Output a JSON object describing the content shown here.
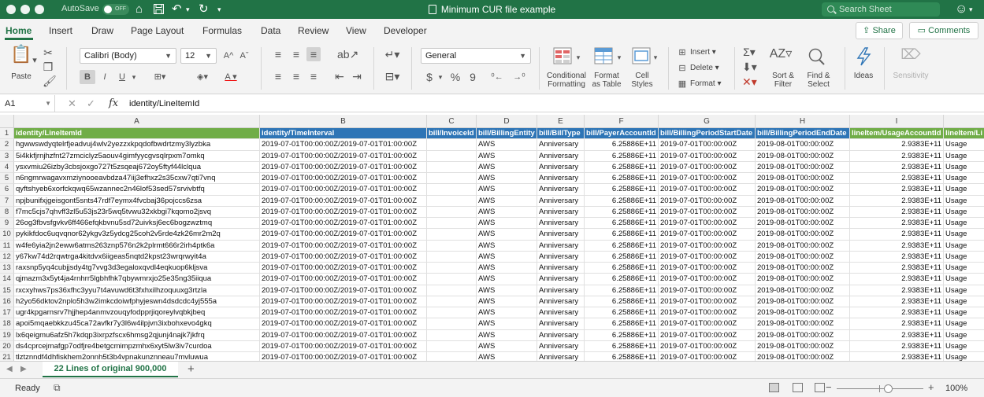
{
  "window": {
    "autosave_label": "AutoSave",
    "autosave_state": "OFF",
    "title": "Minimum CUR file example",
    "search_placeholder": "Search Sheet"
  },
  "ribbon_tabs": [
    "Home",
    "Insert",
    "Draw",
    "Page Layout",
    "Formulas",
    "Data",
    "Review",
    "View",
    "Developer"
  ],
  "actions": {
    "share": "Share",
    "comments": "Comments"
  },
  "ribbon": {
    "paste": "Paste",
    "font_name": "Calibri (Body)",
    "font_size": "12",
    "bold": "B",
    "italic": "I",
    "underline": "U",
    "number_format": "General",
    "currency": "$",
    "percent": "%",
    "comma": "9",
    "conditional_formatting": [
      "Conditional",
      "Formatting"
    ],
    "format_as_table": [
      "Format",
      "as Table"
    ],
    "cell_styles": [
      "Cell",
      "Styles"
    ],
    "insert": "Insert",
    "delete": "Delete",
    "format": "Format",
    "sort_filter": [
      "Sort &",
      "Filter"
    ],
    "find_select": [
      "Find &",
      "Select"
    ],
    "ideas": "Ideas",
    "sensitivity": "Sensitivity"
  },
  "formula_bar": {
    "name_box": "A1",
    "fx": "fx",
    "content": "identity/LineItemId"
  },
  "grid": {
    "column_letters": [
      "A",
      "B",
      "C",
      "D",
      "E",
      "F",
      "G",
      "H",
      "I"
    ],
    "headers": [
      "identity/LineItemId",
      "identity/TimeInterval",
      "bill/InvoiceId",
      "bill/BillingEntity",
      "bill/BillType",
      "bill/PayerAccountId",
      "bill/BillingPeriodStartDate",
      "bill/BillingPeriodEndDate",
      "lineItem/UsageAccountId",
      "lineItem/Li"
    ],
    "row_numbers": [
      "1",
      "2",
      "3",
      "4",
      "5",
      "6",
      "7",
      "8",
      "9",
      "10",
      "11",
      "12",
      "13",
      "14",
      "15",
      "16",
      "17",
      "18",
      "19",
      "20",
      "21"
    ],
    "rows": [
      [
        "hgwwswdyqtelrfjeadvuj4wlv2yezzxkpqdofbwdrtzmy3lyzbka",
        "2019-07-01T00:00:00Z/2019-07-01T01:00:00Z",
        "",
        "AWS",
        "Anniversary",
        "6.25886E+11",
        "2019-07-01T00:00:00Z",
        "2019-08-01T00:00:00Z",
        "2.9383E+11",
        "Usage"
      ],
      [
        "5i4kkfjrnjhzfnt27zmciclyz5aouv4gimfyycgvsqlrpxm7omkq",
        "2019-07-01T00:00:00Z/2019-07-01T01:00:00Z",
        "",
        "AWS",
        "Anniversary",
        "6.25886E+11",
        "2019-07-01T00:00:00Z",
        "2019-08-01T00:00:00Z",
        "2.9383E+11",
        "Usage"
      ],
      [
        "ysxvmiu26izby3cbsjoxgo727t5zsqeaj672oy5ftyf44lclqua",
        "2019-07-01T00:00:00Z/2019-07-01T01:00:00Z",
        "",
        "AWS",
        "Anniversary",
        "6.25886E+11",
        "2019-07-01T00:00:00Z",
        "2019-08-01T00:00:00Z",
        "2.9383E+11",
        "Usage"
      ],
      [
        "n6ngmrwagavxmziynooeavbdza47iij3efhxz2s35cxw7qti7vnq",
        "2019-07-01T00:00:00Z/2019-07-01T01:00:00Z",
        "",
        "AWS",
        "Anniversary",
        "6.25886E+11",
        "2019-07-01T00:00:00Z",
        "2019-08-01T00:00:00Z",
        "2.9383E+11",
        "Usage"
      ],
      [
        "qyftshyeb6xorfckqwq65wzannec2n46lof53sed57srvivbtfq",
        "2019-07-01T00:00:00Z/2019-07-01T01:00:00Z",
        "",
        "AWS",
        "Anniversary",
        "6.25886E+11",
        "2019-07-01T00:00:00Z",
        "2019-08-01T00:00:00Z",
        "2.9383E+11",
        "Usage"
      ],
      [
        "npjbunifxjgeisgont5snts47rdf7eymx4fvcbaj36pojccs6zsa",
        "2019-07-01T00:00:00Z/2019-07-01T01:00:00Z",
        "",
        "AWS",
        "Anniversary",
        "6.25886E+11",
        "2019-07-01T00:00:00Z",
        "2019-08-01T00:00:00Z",
        "2.9383E+11",
        "Usage"
      ],
      [
        "f7mc5cjs7qhvff3zl5u53js23r5wq5tvwu32xkbgi7kqomo2jsvq",
        "2019-07-01T00:00:00Z/2019-07-01T01:00:00Z",
        "",
        "AWS",
        "Anniversary",
        "6.25886E+11",
        "2019-07-01T00:00:00Z",
        "2019-08-01T00:00:00Z",
        "2.9383E+11",
        "Usage"
      ],
      [
        "26og3fbvsfgvkv6ff466efqkbvnu5sd72uivksj6ec6bogzwztmq",
        "2019-07-01T00:00:00Z/2019-07-01T01:00:00Z",
        "",
        "AWS",
        "Anniversary",
        "6.25886E+11",
        "2019-07-01T00:00:00Z",
        "2019-08-01T00:00:00Z",
        "2.9383E+11",
        "Usage"
      ],
      [
        "pykikfdoc6uqvqnor62ykgv3z5ydcg25coh2v5rde4zk26mr2m2q",
        "2019-07-01T00:00:00Z/2019-07-01T01:00:00Z",
        "",
        "AWS",
        "Anniversary",
        "6.25886E+11",
        "2019-07-01T00:00:00Z",
        "2019-08-01T00:00:00Z",
        "2.9383E+11",
        "Usage"
      ],
      [
        "w4fe6yia2jn2eww6atms263znp576n2k2plrmt666r2irh4ptk6a",
        "2019-07-01T00:00:00Z/2019-07-01T01:00:00Z",
        "",
        "AWS",
        "Anniversary",
        "6.25886E+11",
        "2019-07-01T00:00:00Z",
        "2019-08-01T00:00:00Z",
        "2.9383E+11",
        "Usage"
      ],
      [
        "y67kw74d2rqwtrga4kitdvx6iigeas5nqtd2kpst23wrqrwyit4a",
        "2019-07-01T00:00:00Z/2019-07-01T01:00:00Z",
        "",
        "AWS",
        "Anniversary",
        "6.25886E+11",
        "2019-07-01T00:00:00Z",
        "2019-08-01T00:00:00Z",
        "2.9383E+11",
        "Usage"
      ],
      [
        "raxsnp5yq4cubjjsdy4tg7vvg3d3egaloxqvdl4eqkuop6kljsva",
        "2019-07-01T00:00:00Z/2019-07-01T01:00:00Z",
        "",
        "AWS",
        "Anniversary",
        "6.25886E+11",
        "2019-07-01T00:00:00Z",
        "2019-08-01T00:00:00Z",
        "2.9383E+11",
        "Usage"
      ],
      [
        "qjmazm3x5yt4ja4rnhrr5lgbhfhk7qbywmrxjo25e35ng35iiqua",
        "2019-07-01T00:00:00Z/2019-07-01T01:00:00Z",
        "",
        "AWS",
        "Anniversary",
        "6.25886E+11",
        "2019-07-01T00:00:00Z",
        "2019-08-01T00:00:00Z",
        "2.9383E+11",
        "Usage"
      ],
      [
        "rxcxyhws7ps36xfhc3yyu7t4avuwd6t3fxhxilhzoquuxg3rtzla",
        "2019-07-01T00:00:00Z/2019-07-01T01:00:00Z",
        "",
        "AWS",
        "Anniversary",
        "6.25886E+11",
        "2019-07-01T00:00:00Z",
        "2019-08-01T00:00:00Z",
        "2.9383E+11",
        "Usage"
      ],
      [
        "h2yo56dktov2nplo5h3w2imkcdoiwfphyjeswn4dsdcdc4yj555a",
        "2019-07-01T00:00:00Z/2019-07-01T01:00:00Z",
        "",
        "AWS",
        "Anniversary",
        "6.25886E+11",
        "2019-07-01T00:00:00Z",
        "2019-08-01T00:00:00Z",
        "2.9383E+11",
        "Usage"
      ],
      [
        "ugr4kpgarnsrv7hjjhep4anmvzouqyfodpprjiqoreylvqbkjbeq",
        "2019-07-01T00:00:00Z/2019-07-01T01:00:00Z",
        "",
        "AWS",
        "Anniversary",
        "6.25886E+11",
        "2019-07-01T00:00:00Z",
        "2019-08-01T00:00:00Z",
        "2.9383E+11",
        "Usage"
      ],
      [
        "apoi5mqaebkkzu45ca72avfkr7y3l6w4ilpjvn3ixbohxevo4gkq",
        "2019-07-01T00:00:00Z/2019-07-01T01:00:00Z",
        "",
        "AWS",
        "Anniversary",
        "6.25886E+11",
        "2019-07-01T00:00:00Z",
        "2019-08-01T00:00:00Z",
        "2.9383E+11",
        "Usage"
      ],
      [
        "lx6qeigmu6afz5h7kdqp3ixrpzfscx6hmsg2qjunj4najk7jkfrq",
        "2019-07-01T00:00:00Z/2019-07-01T01:00:00Z",
        "",
        "AWS",
        "Anniversary",
        "6.25886E+11",
        "2019-07-01T00:00:00Z",
        "2019-08-01T00:00:00Z",
        "2.9383E+11",
        "Usage"
      ],
      [
        "ds4cprcejmafgp7odfjre4betgcmimpzmhx6xyt5lw3iv7curdoa",
        "2019-07-01T00:00:00Z/2019-07-01T01:00:00Z",
        "",
        "AWS",
        "Anniversary",
        "6.25886E+11",
        "2019-07-01T00:00:00Z",
        "2019-08-01T00:00:00Z",
        "2.9383E+11",
        "Usage"
      ],
      [
        "tlztznndf4dhfiskhem2onnh5t3b4vpnakunznneau7mvluwua",
        "2019-07-01T00:00:00Z/2019-07-01T01:00:00Z",
        "",
        "AWS",
        "Anniversary",
        "6.25886E+11",
        "2019-07-01T00:00:00Z",
        "2019-08-01T00:00:00Z",
        "2.9383E+11",
        "Usage"
      ]
    ]
  },
  "sheet_tab": "22 Lines of original 900,000",
  "status": {
    "ready": "Ready",
    "zoom": "100%"
  },
  "colors": {
    "brand": "#217346",
    "header_green": "#70ad47",
    "header_blue": "#2e75b6"
  },
  "icons": [
    "home-icon",
    "save-icon",
    "undo-icon",
    "redo-icon",
    "search-icon",
    "smiley-icon"
  ]
}
